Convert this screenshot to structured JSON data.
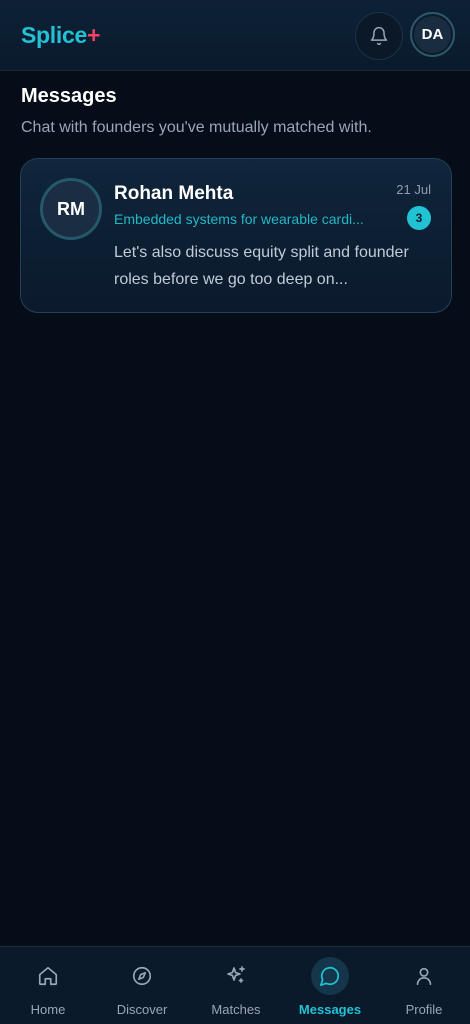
{
  "header": {
    "logo_text": "Splice",
    "logo_plus": "+",
    "user_initials": "DA"
  },
  "page": {
    "title": "Messages",
    "subtitle": "Chat with founders you've mutually matched with."
  },
  "conversations": [
    {
      "initials": "RM",
      "name": "Rohan Mehta",
      "project": "Embedded systems for wearable cardi...",
      "date": "21 Jul",
      "unread": "3",
      "preview": "Let's also discuss equity split and founder roles before we go too deep on..."
    }
  ],
  "nav": {
    "items": [
      {
        "label": "Home",
        "icon": "home-icon"
      },
      {
        "label": "Discover",
        "icon": "compass-icon"
      },
      {
        "label": "Matches",
        "icon": "sparkles-icon"
      },
      {
        "label": "Messages",
        "icon": "chat-bubble-icon",
        "active": true
      },
      {
        "label": "Profile",
        "icon": "user-icon"
      }
    ]
  },
  "colors": {
    "accent": "#22c1d3",
    "logo_plus": "#ef4461",
    "background": "#060c18"
  }
}
